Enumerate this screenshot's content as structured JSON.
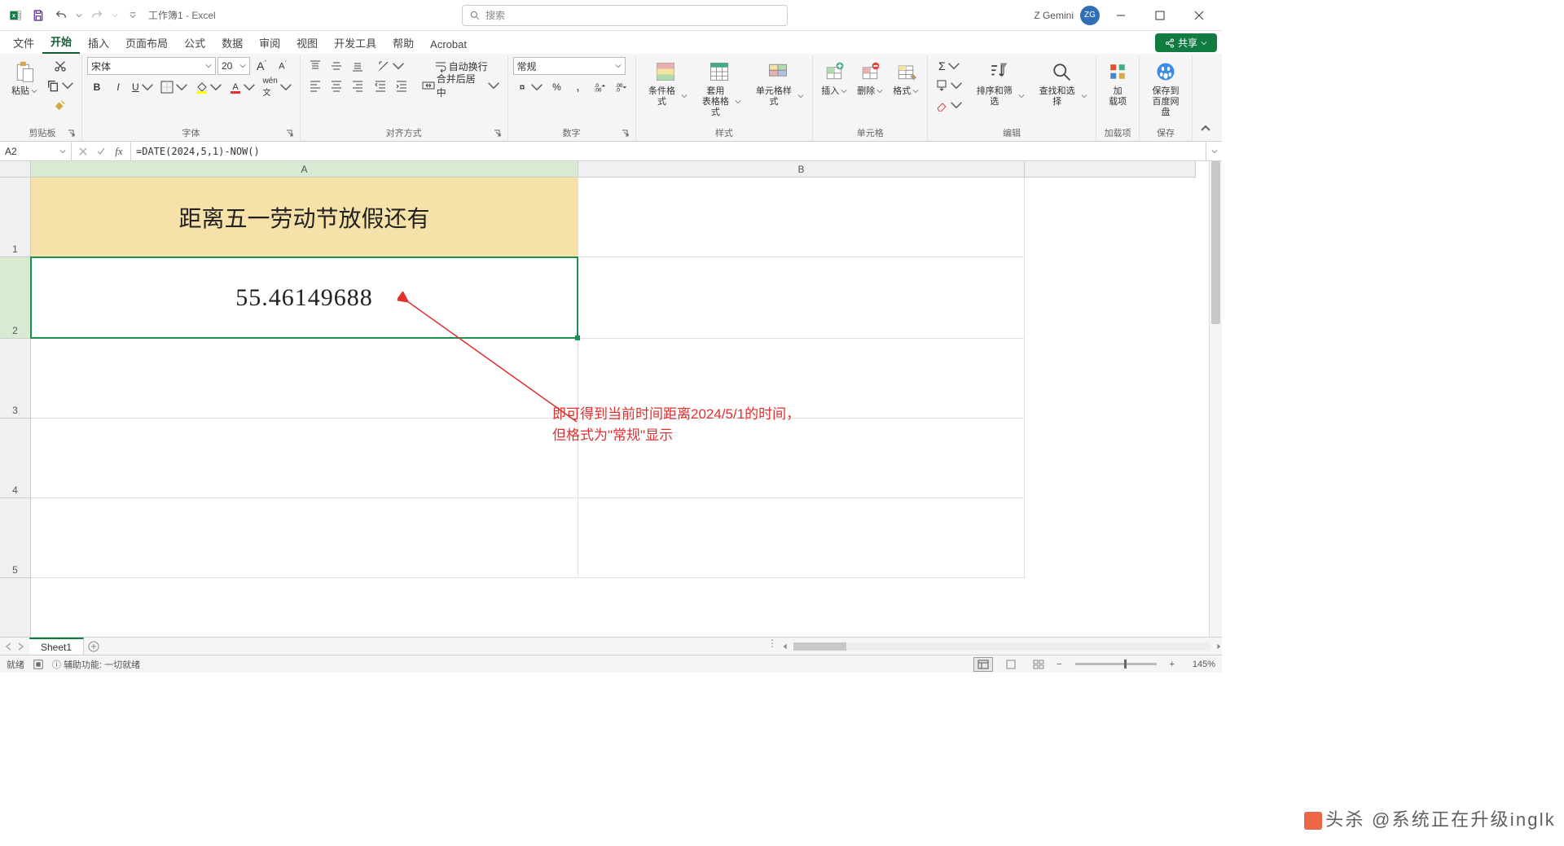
{
  "title_bar": {
    "doc_title": "工作簿1 - Excel",
    "search_placeholder": "搜索",
    "user_name": "Z Gemini",
    "user_initials": "ZG"
  },
  "tabs": {
    "file": "文件",
    "home": "开始",
    "insert": "插入",
    "layout": "页面布局",
    "formulas": "公式",
    "data": "数据",
    "review": "审阅",
    "view": "视图",
    "dev": "开发工具",
    "help": "帮助",
    "acrobat": "Acrobat",
    "share": "共享"
  },
  "ribbon": {
    "clipboard": {
      "paste": "粘贴",
      "label": "剪贴板"
    },
    "font": {
      "name": "宋体",
      "size": "20",
      "label": "字体"
    },
    "align": {
      "wrap": "自动换行",
      "merge": "合并后居中",
      "label": "对齐方式"
    },
    "number": {
      "format": "常规",
      "label": "数字"
    },
    "styles": {
      "cond": "条件格式",
      "table": "套用\n表格格式",
      "cell": "单元格样式",
      "label": "样式"
    },
    "cells": {
      "insert": "插入",
      "delete": "删除",
      "format": "格式",
      "label": "单元格"
    },
    "editing": {
      "sort": "排序和筛选",
      "find": "查找和选择",
      "label": "编辑"
    },
    "addins": {
      "addins": "加\n载项",
      "label": "加载项"
    },
    "save": {
      "baidu": "保存到\n百度网盘",
      "label": "保存"
    }
  },
  "formula_bar": {
    "name_box": "A2",
    "formula": "=DATE(2024,5,1)-NOW()"
  },
  "grid": {
    "col_a": "A",
    "col_b": "B",
    "rows": [
      "1",
      "2",
      "3",
      "4",
      "5"
    ],
    "a1": "距离五一劳动节放假还有",
    "a2": "55.46149688",
    "annotation_l1": "即可得到当前时间距离2024/5/1的时间，",
    "annotation_l2": "但格式为\"常规\"显示"
  },
  "sheets": {
    "sheet1": "Sheet1"
  },
  "status_bar": {
    "ready": "就绪",
    "access": "辅助功能: 一切就绪",
    "zoom": "145%"
  },
  "watermark": "头杀 @系统正在升级inglk"
}
